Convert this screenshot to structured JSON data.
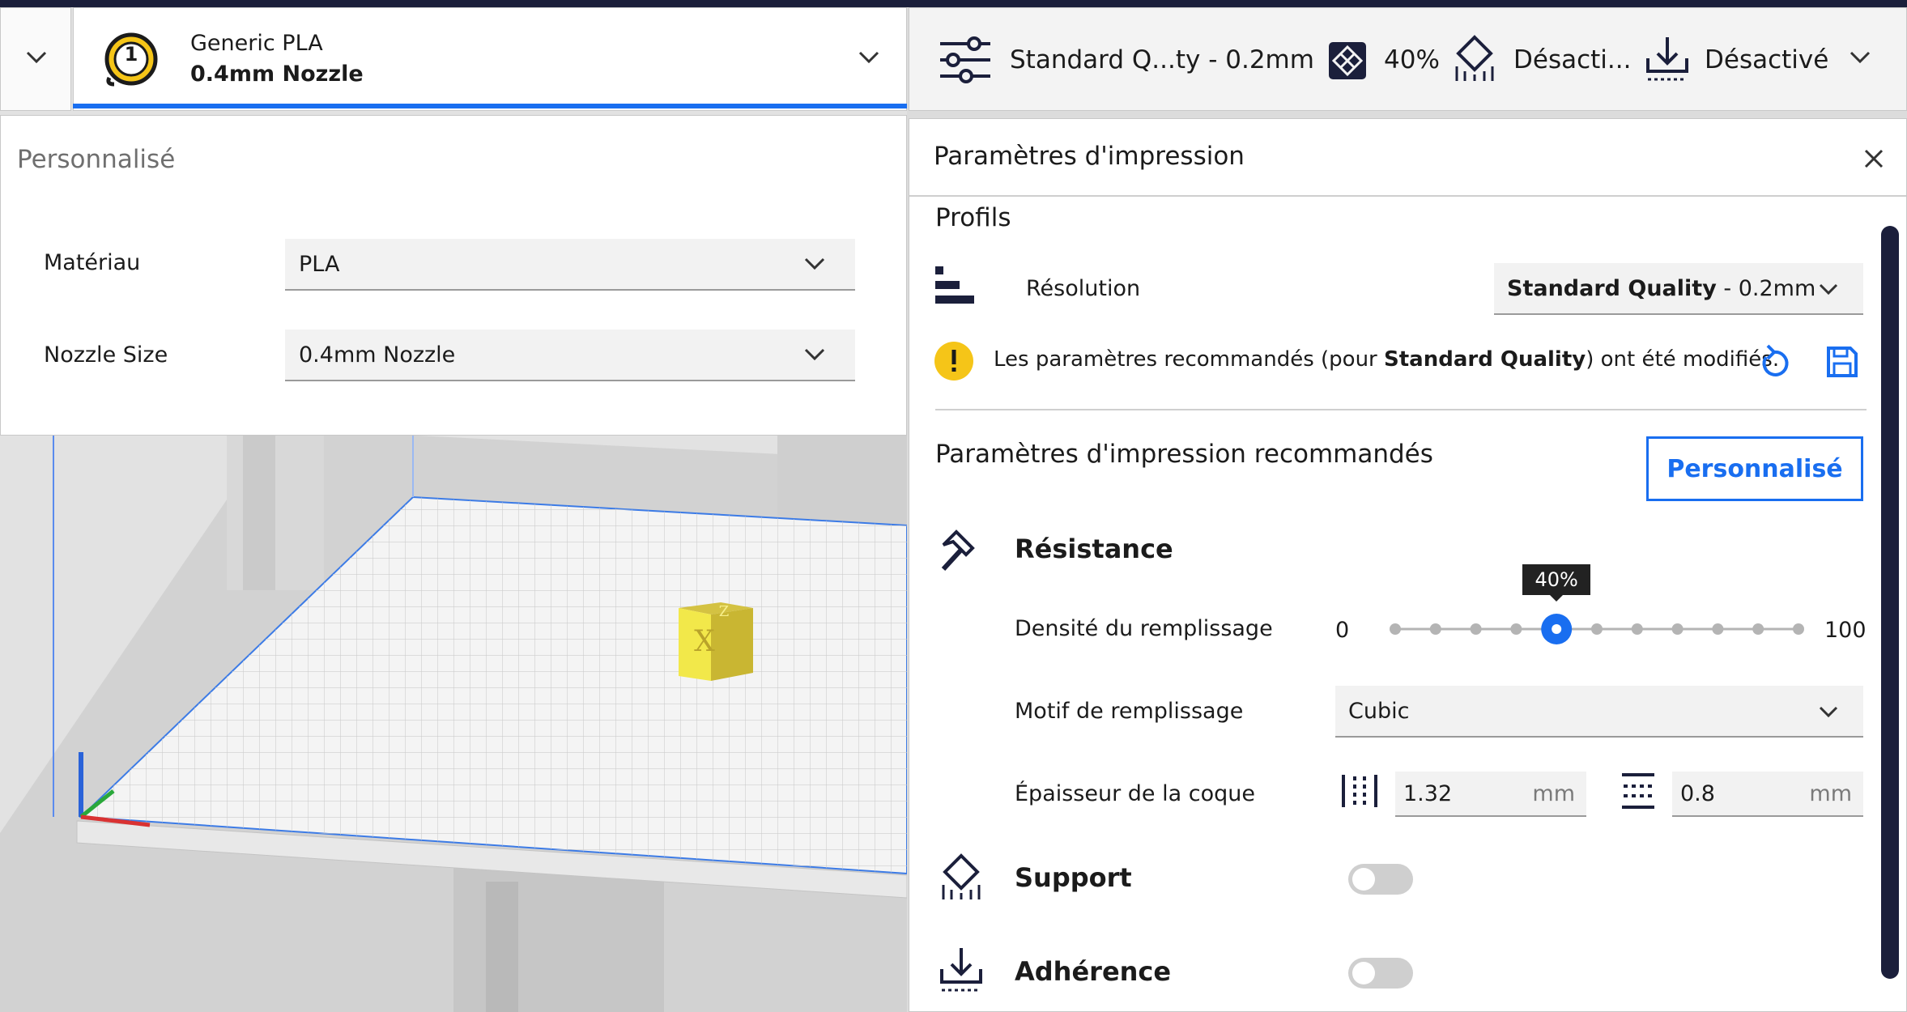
{
  "extruder": {
    "number": "1",
    "material_name": "Generic PLA",
    "nozzle_name": "0.4mm Nozzle"
  },
  "extruder_panel": {
    "mode_title": "Personnalisé",
    "material_label": "Matériau",
    "material_value": "PLA",
    "nozzle_label": "Nozzle Size",
    "nozzle_value": "0.4mm Nozzle"
  },
  "print_header": {
    "profile": "Standard Q...ty - 0.2mm",
    "infill": "40%",
    "support": "Désacti...",
    "adhesion": "Désactivé"
  },
  "print_panel": {
    "title": "Paramètres d'impression",
    "profiles_heading": "Profils",
    "resolution_label": "Résolution",
    "resolution_value_bold": "Standard Quality",
    "resolution_value_rest": " - 0.2mm",
    "warning_pre": "Les paramètres recommandés (pour ",
    "warning_bold": "Standard Quality",
    "warning_post": ") ont été modifiés.",
    "recommended_heading": "Paramètres d'impression recommandés",
    "custom_button": "Personnalisé",
    "strength_heading": "Résistance",
    "infill_density_label": "Densité du remplissage",
    "slider_min": "0",
    "slider_max": "100",
    "slider_value_label": "40%",
    "slider_value": 40,
    "infill_pattern_label": "Motif de remplissage",
    "infill_pattern_value": "Cubic",
    "shell_label": "Épaisseur de la coque",
    "wall_value": "1.32",
    "wall_unit": "mm",
    "topbottom_value": "0.8",
    "topbottom_unit": "mm",
    "support_heading": "Support",
    "adhesion_heading": "Adhérence",
    "support_enabled": false,
    "adhesion_enabled": false
  },
  "colors": {
    "accent": "#196ef0",
    "dark_icon": "#0b1a4a",
    "warning": "#f5c518",
    "tooltip_bg": "#222222"
  }
}
